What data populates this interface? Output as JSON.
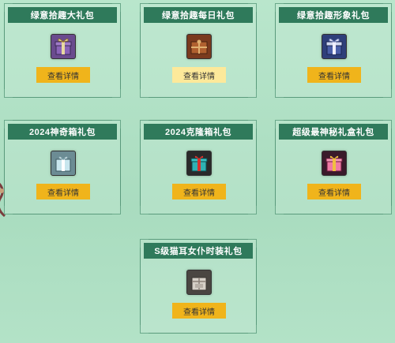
{
  "cards": [
    {
      "title": "绿意拾趣大礼包",
      "button": "查看详情",
      "icon": "purple-ribbon-gift-icon",
      "icon_color": "#7e5aa8"
    },
    {
      "title": "绿意拾趣每日礼包",
      "button": "查看详情",
      "icon": "brown-box-gift-icon",
      "icon_color": "#a0552e"
    },
    {
      "title": "绿意拾趣形象礼包",
      "button": "查看详情",
      "icon": "blue-ribbon-gift-icon",
      "icon_color": "#5a6fb0"
    },
    {
      "title": "2024神奇箱礼包",
      "button": "查看详情",
      "icon": "silver-gift-box-icon",
      "icon_color": "#a9d7e0"
    },
    {
      "title": "2024克隆箱礼包",
      "button": "查看详情",
      "icon": "teal-red-gift-box-icon",
      "icon_color": "#2fa6a8"
    },
    {
      "title": "超级最神秘礼盒礼包",
      "button": "查看详情",
      "icon": "pink-gift-box-icon",
      "icon_color": "#e05c8a"
    },
    {
      "title": "S级猫耳女仆时装礼包",
      "button": "查看详情",
      "icon": "grey-package-icon",
      "icon_color": "#b8b0a8"
    }
  ],
  "colors": {
    "title_bar": "#2f7a5b",
    "button": "#f0b41b",
    "button_highlight": "#fde99a",
    "background": "#b0e0c4"
  }
}
